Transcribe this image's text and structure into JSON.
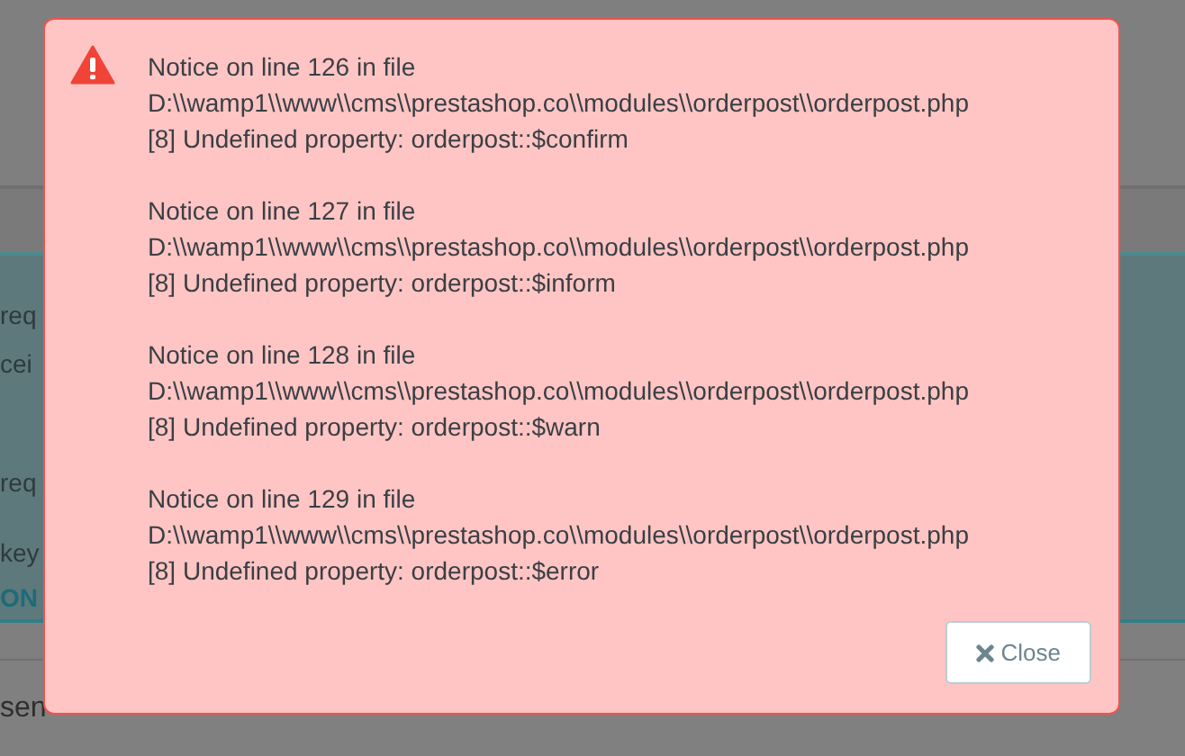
{
  "background": {
    "panel_lines": [
      {
        "text": "req",
        "bold": false
      },
      {
        "text": "cei",
        "bold": false
      },
      {
        "text": "req",
        "bold": false
      },
      {
        "text": "key",
        "bold": false
      },
      {
        "text": "ON",
        "bold": true
      }
    ],
    "footer_text": "sen"
  },
  "dialog": {
    "notices": [
      {
        "heading": "Notice on line 126 in file",
        "path": "D:\\\\wamp1\\\\www\\\\cms\\\\prestashop.co\\\\modules\\\\orderpost\\\\orderpost.php",
        "message": "[8] Undefined property: orderpost::$confirm"
      },
      {
        "heading": "Notice on line 127 in file",
        "path": "D:\\\\wamp1\\\\www\\\\cms\\\\prestashop.co\\\\modules\\\\orderpost\\\\orderpost.php",
        "message": "[8] Undefined property: orderpost::$inform"
      },
      {
        "heading": "Notice on line 128 in file",
        "path": "D:\\\\wamp1\\\\www\\\\cms\\\\prestashop.co\\\\modules\\\\orderpost\\\\orderpost.php",
        "message": "[8] Undefined property: orderpost::$warn"
      },
      {
        "heading": "Notice on line 129 in file",
        "path": "D:\\\\wamp1\\\\www\\\\cms\\\\prestashop.co\\\\modules\\\\orderpost\\\\orderpost.php",
        "message": "[8] Undefined property: orderpost::$error"
      }
    ],
    "close_button": "Close"
  }
}
